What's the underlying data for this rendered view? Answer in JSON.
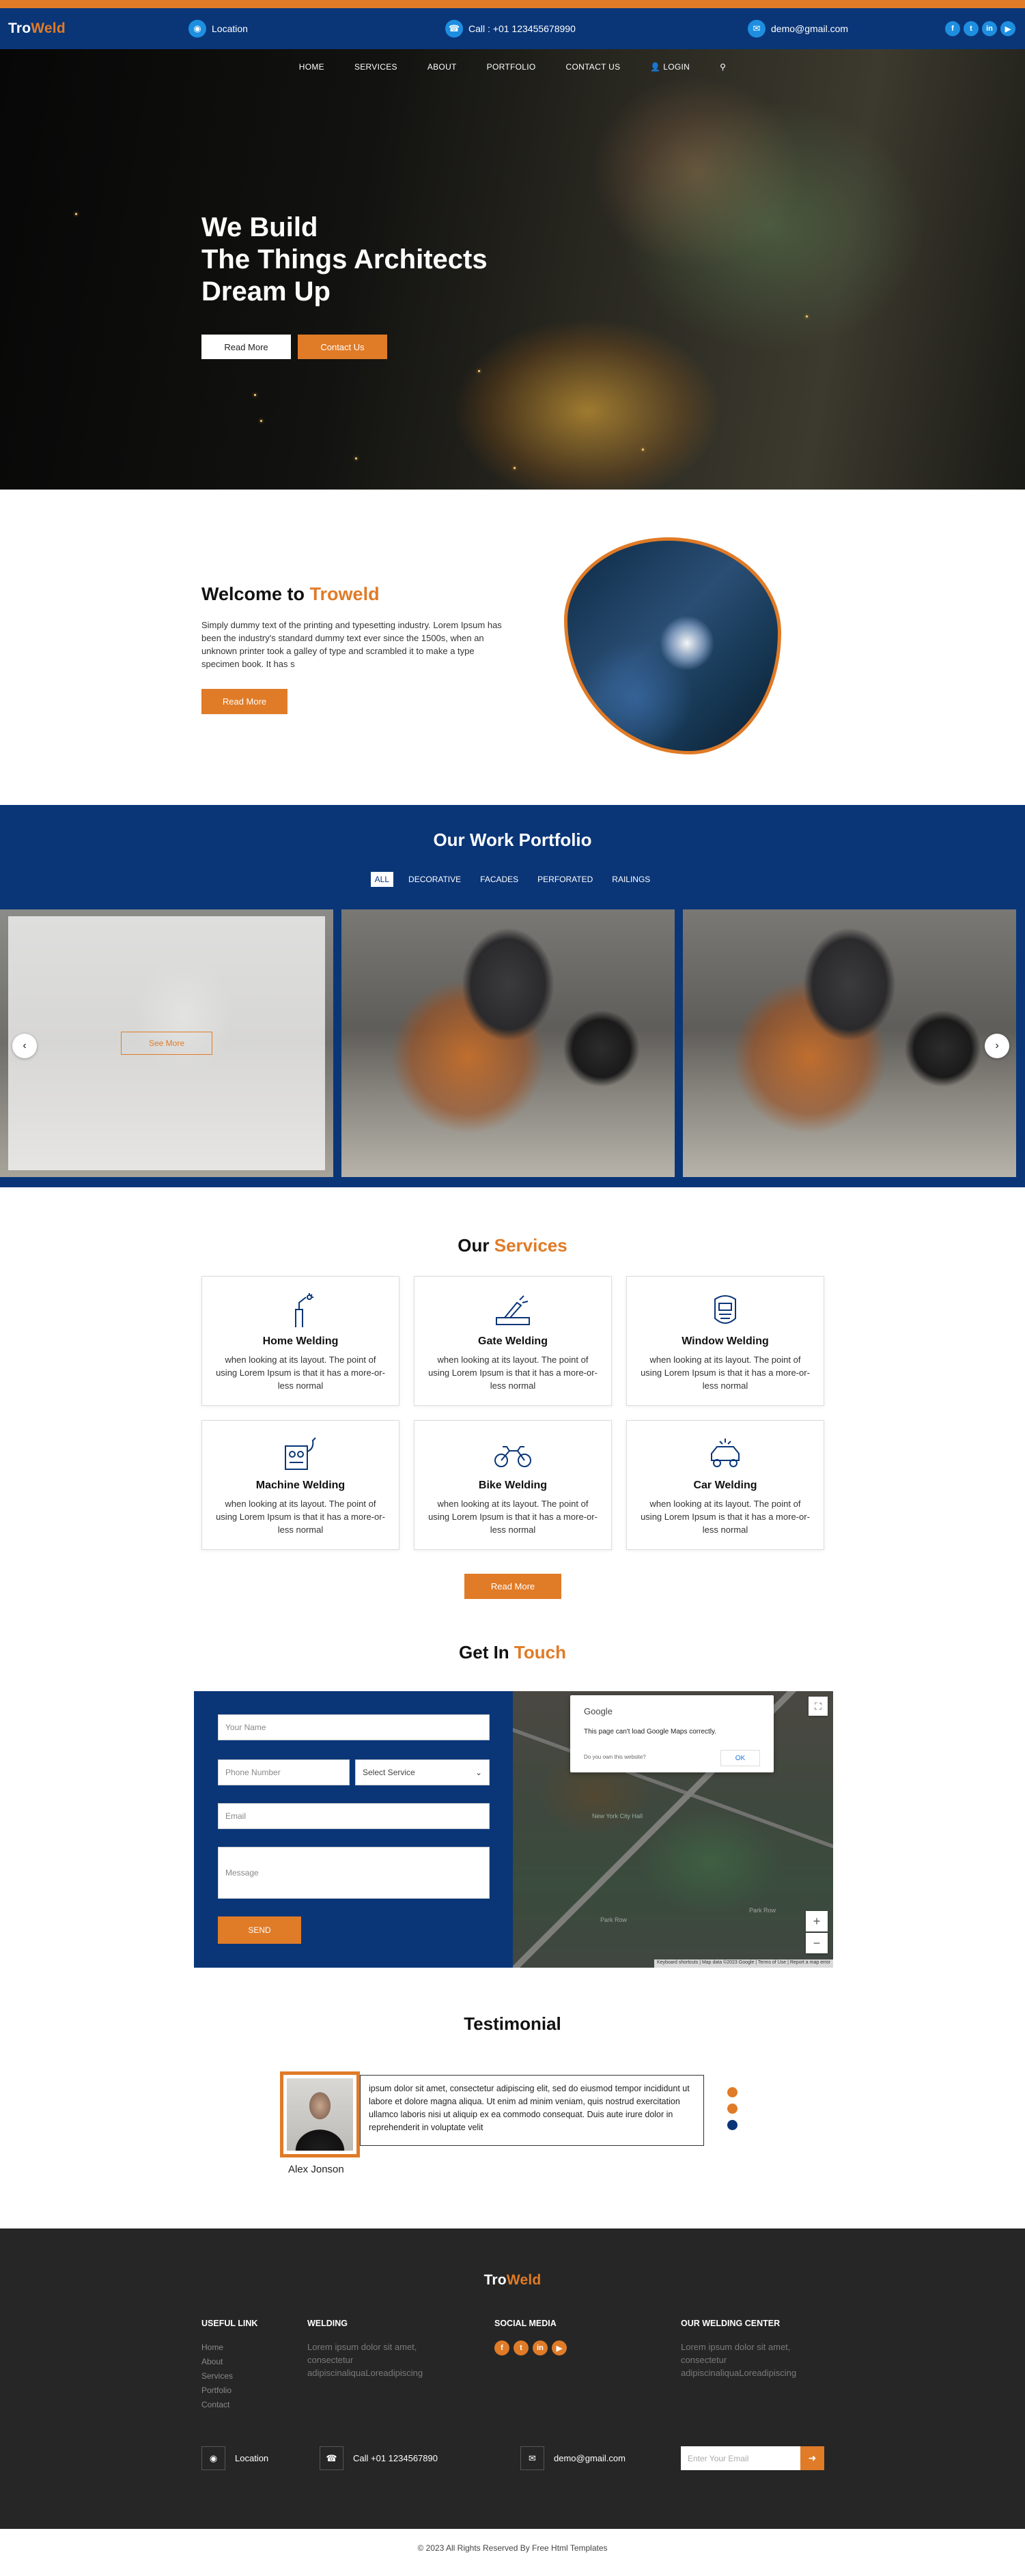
{
  "header": {
    "logo": {
      "part1": "Tro",
      "part2": "Weld"
    },
    "location": "Location",
    "phone": "Call : +01 123455678990",
    "email": "demo@gmail.com",
    "socials": [
      "f",
      "t",
      "in",
      "yt"
    ]
  },
  "nav": {
    "items": [
      "HOME",
      "SERVICES",
      "ABOUT",
      "PORTFOLIO",
      "CONTACT US"
    ],
    "login": "LOGIN"
  },
  "hero": {
    "title_line1": "We Build",
    "title_line2": "The Things Architects",
    "title_line3": "Dream Up",
    "btn_read_more": "Read More",
    "btn_contact": "Contact Us"
  },
  "welcome": {
    "title_prefix": "Welcome to",
    "title_accent": "Troweld",
    "text": "Simply dummy text of the printing and typesetting industry. Lorem Ipsum has been the industry's standard dummy text ever since the 1500s, when an unknown printer took a galley of type and scrambled it to make a type specimen book. It has s",
    "button": "Read More"
  },
  "portfolio": {
    "title": "Our Work Portfolio",
    "filters": [
      "ALL",
      "DECORATIVE",
      "FACADES",
      "PERFORATED",
      "RAILINGS"
    ],
    "active_filter": "ALL",
    "see_more": "See More",
    "prev_icon": "chevron-left-icon",
    "next_icon": "chevron-right-icon"
  },
  "services": {
    "title_prefix": "Our",
    "title_accent": "Services",
    "cards": [
      {
        "title": "Home Welding",
        "text": "when looking at its layout. The point of using Lorem Ipsum is that it has a more-or-less normal",
        "icon": "welding-torch-icon"
      },
      {
        "title": "Gate Welding",
        "text": "when looking at its layout. The point of using Lorem Ipsum is that it has a more-or-less normal",
        "icon": "gate-welding-icon"
      },
      {
        "title": "Window Welding",
        "text": "when looking at its layout. The point of using Lorem Ipsum is that it has a more-or-less normal",
        "icon": "welding-mask-icon"
      },
      {
        "title": "Machine Welding",
        "text": "when looking at its layout. The point of using Lorem Ipsum is that it has a more-or-less normal",
        "icon": "welding-machine-icon"
      },
      {
        "title": "Bike Welding",
        "text": "when looking at its layout. The point of using Lorem Ipsum is that it has a more-or-less normal",
        "icon": "motorbike-icon"
      },
      {
        "title": "Car Welding",
        "text": "when looking at its layout. The point of using Lorem Ipsum is that it has a more-or-less normal",
        "icon": "car-icon"
      }
    ],
    "button": "Read More"
  },
  "contact": {
    "title_prefix": "Get In",
    "title_accent": "Touch",
    "name_placeholder": "Your Name",
    "phone_placeholder": "Phone Number",
    "service_select": "Select Service",
    "email_placeholder": "Email",
    "message_placeholder": "Message",
    "send": "SEND",
    "map": {
      "provider": "Google",
      "message": "This page can't load Google Maps correctly.",
      "own_site": "Do you own this website?",
      "ok": "OK",
      "attribution": "Keyboard shortcuts | Map data ©2023 Google | Terms of Use | Report a map error",
      "labels": [
        "New York City Hall",
        "Park Row",
        "Park Row"
      ]
    }
  },
  "testimonial": {
    "title": "Testimonial",
    "quote": "ipsum dolor sit amet, consectetur adipiscing elit, sed do eiusmod tempor incididunt ut labore et dolore magna aliqua. Ut enim ad minim veniam, quis nostrud exercitation ullamco laboris nisi ut aliquip ex ea commodo consequat. Duis aute irure dolor in reprehenderit in voluptate velit",
    "author": "Alex Jonson"
  },
  "footer": {
    "logo": {
      "part1": "Tro",
      "part2": "Weld"
    },
    "useful_title": "USEFUL LINK",
    "useful_links": [
      "Home",
      "About",
      "Services",
      "Portfolio",
      "Contact"
    ],
    "welding_title": "WELDING",
    "welding_text": "Lorem ipsum dolor sit amet, consectetur adipiscinaliquaLoreadipiscing",
    "social_title": "SOCIAL MEDIA",
    "center_title": "OUR WELDING CENTER",
    "center_text": "Lorem ipsum dolor sit amet, consectetur adipiscinaliquaLoreadipiscing",
    "location": "Location",
    "phone": "Call +01 1234567890",
    "email": "demo@gmail.com",
    "email_placeholder": "Enter Your Email"
  },
  "copyright": "© 2023 All Rights Reserved By Free Html Templates",
  "colors": {
    "primary": "#0a3678",
    "accent": "#e07b27",
    "footer": "#262626"
  }
}
